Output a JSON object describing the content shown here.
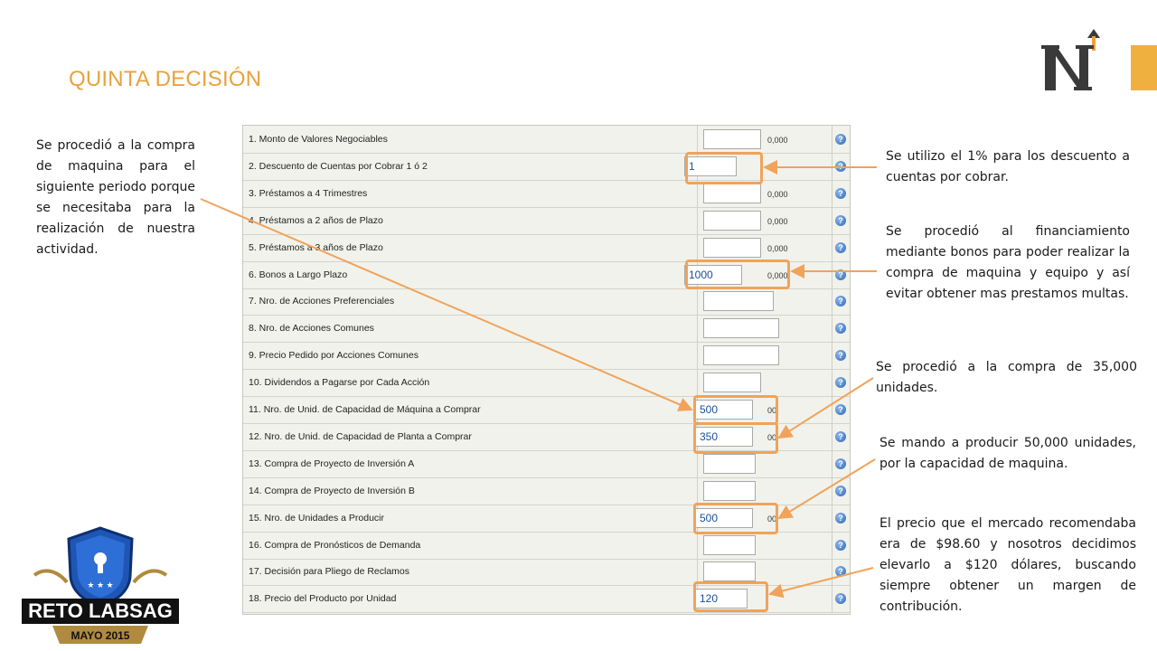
{
  "title": "QUINTA DECISIÓN",
  "notes": {
    "left": "Se procedió a la compra de maquina para el siguiente periodo porque se necesitaba para la realización de nuestra actividad.",
    "r1": "Se utilizo el 1% para los descuento a cuentas por cobrar.",
    "r2": "Se procedió al financiamiento mediante bonos para poder realizar la compra de maquina y equipo y así evitar obtener mas prestamos multas.",
    "r3": "Se procedió a la compra de 35,000 unidades.",
    "r4": "Se mando a producir 50,000 unidades, por la capacidad de maquina.",
    "r5": "El precio que el mercado recomendaba era de $98.60 y nosotros decidimos elevarlo a $120 dólares, buscando siempre obtener un margen de contribución."
  },
  "rows": [
    {
      "label": "1. Monto de Valores Negociables",
      "value": "",
      "unit": "0,000"
    },
    {
      "label": "2. Descuento de Cuentas por Cobrar 1 ó 2",
      "value": "1",
      "unit": ""
    },
    {
      "label": "3. Préstamos a 4 Trimestres",
      "value": "",
      "unit": "0,000"
    },
    {
      "label": "4. Préstamos a 2 años de Plazo",
      "value": "",
      "unit": "0,000"
    },
    {
      "label": "5. Préstamos a 3 años de Plazo",
      "value": "",
      "unit": "0,000"
    },
    {
      "label": "6. Bonos a Largo Plazo",
      "value": "1000",
      "unit": "0,000"
    },
    {
      "label": "7. Nro. de Acciones Preferenciales",
      "value": "",
      "unit": ""
    },
    {
      "label": "8. Nro. de Acciones Comunes",
      "value": "",
      "unit": ""
    },
    {
      "label": "9. Precio Pedido por Acciones Comunes",
      "value": "",
      "unit": ""
    },
    {
      "label": "10. Dividendos a Pagarse por Cada Acción",
      "value": "",
      "unit": ""
    },
    {
      "label": "11. Nro. de Unid. de Capacidad de Máquina a Comprar",
      "value": "500",
      "unit": "00"
    },
    {
      "label": "12. Nro. de Unid. de Capacidad de Planta a Comprar",
      "value": "350",
      "unit": "00"
    },
    {
      "label": "13. Compra de Proyecto de Inversión A",
      "value": "",
      "unit": ""
    },
    {
      "label": "14. Compra de Proyecto de Inversión B",
      "value": "",
      "unit": ""
    },
    {
      "label": "15. Nro. de Unidades a Producir",
      "value": "500",
      "unit": "00"
    },
    {
      "label": "16. Compra de Pronósticos de Demanda",
      "value": "",
      "unit": ""
    },
    {
      "label": "17. Decisión para Pliego de Reclamos",
      "value": "",
      "unit": ""
    },
    {
      "label": "18. Precio del Producto por Unidad",
      "value": "120",
      "unit": ""
    }
  ],
  "help_glyph": "?",
  "badge": {
    "line1": "RETO LABSAG",
    "line2": "MAYO 2015"
  },
  "colors": {
    "title": "#e9a23b",
    "highlight": "#f0a35a",
    "arrow": "#f0a35a",
    "badge_blue": "#1f56b5"
  },
  "icons": {
    "logo": "n-arrow-logo",
    "help": "question-circle-icon"
  }
}
